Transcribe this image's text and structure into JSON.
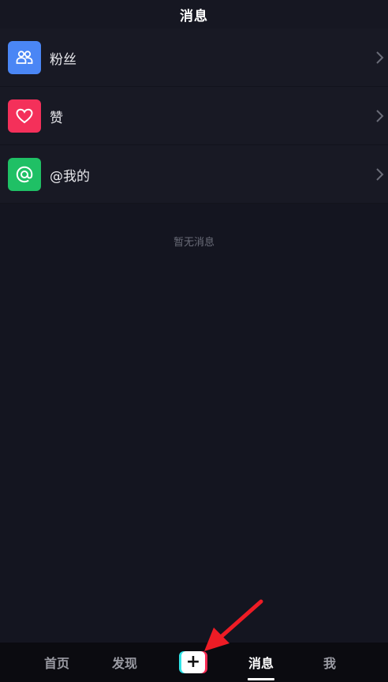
{
  "header": {
    "title": "消息"
  },
  "rows": [
    {
      "label": "粉丝",
      "icon": "fans-icon",
      "color": "#4a86f5"
    },
    {
      "label": "赞",
      "icon": "heart-icon",
      "color": "#f4305a"
    },
    {
      "label": "@我的",
      "icon": "at-icon",
      "color": "#1fc065"
    }
  ],
  "empty_text": "暂无消息",
  "tabbar": {
    "tabs": [
      {
        "label": "首页"
      },
      {
        "label": "发现"
      },
      {
        "label": "消息",
        "active": true
      },
      {
        "label": "我"
      }
    ],
    "plus_label": "+"
  },
  "colors": {
    "background": "#141520",
    "row": "#181924",
    "tabbar": "#0b0b10",
    "arrow": "#ee1c25"
  }
}
